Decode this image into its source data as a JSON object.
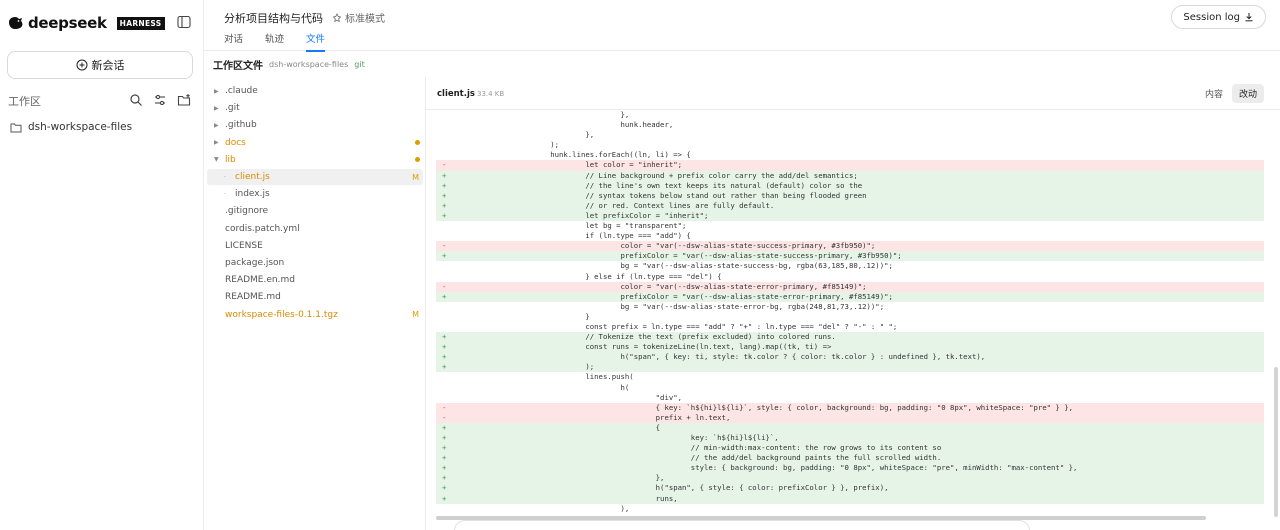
{
  "brand": {
    "name": "deepseek",
    "tag": "HARNESS"
  },
  "sidebar": {
    "new_chat_label": "新会话",
    "workspace_title": "工作区",
    "workspace_items": [
      "dsh-workspace-files"
    ]
  },
  "header": {
    "title": "分析项目结构与代码",
    "mode": "标准模式",
    "tabs": [
      {
        "label": "对话",
        "active": false
      },
      {
        "label": "轨迹",
        "active": false
      },
      {
        "label": "文件",
        "active": true
      }
    ],
    "session_log_label": "Session log"
  },
  "breadcrumb": {
    "title": "工作区文件",
    "workspace": "dsh-workspace-files",
    "vcs": "git"
  },
  "file_tree": [
    {
      "name": ".claude",
      "type": "folder",
      "expanded": false,
      "depth": 0,
      "modified": false,
      "marker": ""
    },
    {
      "name": ".git",
      "type": "folder",
      "expanded": false,
      "depth": 0,
      "modified": false,
      "marker": ""
    },
    {
      "name": ".github",
      "type": "folder",
      "expanded": false,
      "depth": 0,
      "modified": false,
      "marker": ""
    },
    {
      "name": "docs",
      "type": "folder",
      "expanded": false,
      "depth": 0,
      "modified": true,
      "marker": "dot"
    },
    {
      "name": "lib",
      "type": "folder",
      "expanded": true,
      "depth": 0,
      "modified": true,
      "marker": "dot"
    },
    {
      "name": "client.js",
      "type": "file",
      "depth": 1,
      "modified": true,
      "marker": "M",
      "selected": true
    },
    {
      "name": "index.js",
      "type": "file",
      "depth": 1,
      "modified": false,
      "marker": ""
    },
    {
      "name": ".gitignore",
      "type": "file",
      "depth": 0,
      "modified": false,
      "marker": ""
    },
    {
      "name": "cordis.patch.yml",
      "type": "file",
      "depth": 0,
      "modified": false,
      "marker": ""
    },
    {
      "name": "LICENSE",
      "type": "file",
      "depth": 0,
      "modified": false,
      "marker": ""
    },
    {
      "name": "package.json",
      "type": "file",
      "depth": 0,
      "modified": false,
      "marker": ""
    },
    {
      "name": "README.en.md",
      "type": "file",
      "depth": 0,
      "modified": false,
      "marker": ""
    },
    {
      "name": "README.md",
      "type": "file",
      "depth": 0,
      "modified": false,
      "marker": ""
    },
    {
      "name": "workspace-files-0.1.1.tgz",
      "type": "file",
      "depth": 0,
      "modified": true,
      "marker": "M"
    }
  ],
  "editor": {
    "file_name": "client.js",
    "file_size": "33.4 KB",
    "view_modes": [
      {
        "label": "内容",
        "active": false
      },
      {
        "label": "改动",
        "active": true
      }
    ],
    "diff_lines": [
      {
        "type": "ctx",
        "text": "                                          },"
      },
      {
        "type": "ctx",
        "text": "                                          hunk.header,"
      },
      {
        "type": "ctx",
        "text": "                                  },"
      },
      {
        "type": "ctx",
        "text": "                          );"
      },
      {
        "type": "ctx",
        "text": "                          hunk.lines.forEach((ln, li) => {"
      },
      {
        "type": "del",
        "text": "                                  let color = \"inherit\";"
      },
      {
        "type": "add",
        "text": "                                  // Line background + prefix color carry the add/del semantics;"
      },
      {
        "type": "add",
        "text": "                                  // the line's own text keeps its natural (default) color so the"
      },
      {
        "type": "add",
        "text": "                                  // syntax tokens below stand out rather than being flooded green"
      },
      {
        "type": "add",
        "text": "                                  // or red. Context lines are fully default."
      },
      {
        "type": "add",
        "text": "                                  let prefixColor = \"inherit\";"
      },
      {
        "type": "ctx",
        "text": "                                  let bg = \"transparent\";"
      },
      {
        "type": "ctx",
        "text": "                                  if (ln.type === \"add\") {"
      },
      {
        "type": "del",
        "text": "                                          color = \"var(--dsw-alias-state-success-primary, #3fb950)\";"
      },
      {
        "type": "add",
        "text": "                                          prefixColor = \"var(--dsw-alias-state-success-primary, #3fb950)\";"
      },
      {
        "type": "ctx",
        "text": "                                          bg = \"var(--dsw-alias-state-success-bg, rgba(63,185,80,.12))\";"
      },
      {
        "type": "ctx",
        "text": "                                  } else if (ln.type === \"del\") {"
      },
      {
        "type": "del",
        "text": "                                          color = \"var(--dsw-alias-state-error-primary, #f85149)\";"
      },
      {
        "type": "add",
        "text": "                                          prefixColor = \"var(--dsw-alias-state-error-primary, #f85149)\";"
      },
      {
        "type": "ctx",
        "text": "                                          bg = \"var(--dsw-alias-state-error-bg, rgba(248,81,73,.12))\";"
      },
      {
        "type": "ctx",
        "text": "                                  }"
      },
      {
        "type": "ctx",
        "text": "                                  const prefix = ln.type === \"add\" ? \"+\" : ln.type === \"del\" ? \"-\" : \" \";"
      },
      {
        "type": "add",
        "text": "                                  // Tokenize the text (prefix excluded) into colored runs."
      },
      {
        "type": "add",
        "text": "                                  const runs = tokenizeLine(ln.text, lang).map((tk, ti) =>"
      },
      {
        "type": "add",
        "text": "                                          h(\"span\", { key: ti, style: tk.color ? { color: tk.color } : undefined }, tk.text),"
      },
      {
        "type": "add",
        "text": "                                  );"
      },
      {
        "type": "ctx",
        "text": "                                  lines.push("
      },
      {
        "type": "ctx",
        "text": "                                          h("
      },
      {
        "type": "ctx",
        "text": "                                                  \"div\","
      },
      {
        "type": "del",
        "text": "                                                  { key: `h${hi}l${li}`, style: { color, background: bg, padding: \"0 8px\", whiteSpace: \"pre\" } },"
      },
      {
        "type": "del",
        "text": "                                                  prefix + ln.text,"
      },
      {
        "type": "add",
        "text": "                                                  {"
      },
      {
        "type": "add",
        "text": "                                                          key: `h${hi}l${li}`,"
      },
      {
        "type": "add",
        "text": "                                                          // min-width:max-content: the row grows to its content so"
      },
      {
        "type": "add",
        "text": "                                                          // the add/del background paints the full scrolled width."
      },
      {
        "type": "add",
        "text": "                                                          style: { background: bg, padding: \"0 8px\", whiteSpace: \"pre\", minWidth: \"max-content\" },"
      },
      {
        "type": "add",
        "text": "                                                  },"
      },
      {
        "type": "add",
        "text": "                                                  h(\"span\", { style: { color: prefixColor } }, prefix),"
      },
      {
        "type": "add",
        "text": "                                                  runs,"
      },
      {
        "type": "ctx",
        "text": "                                          ),"
      }
    ]
  },
  "colors": {
    "accent": "#1677ff",
    "modified": "#d98a00",
    "add_bg": "#e6f4e7",
    "del_bg": "#fde4e5",
    "git": "#52a35b"
  }
}
